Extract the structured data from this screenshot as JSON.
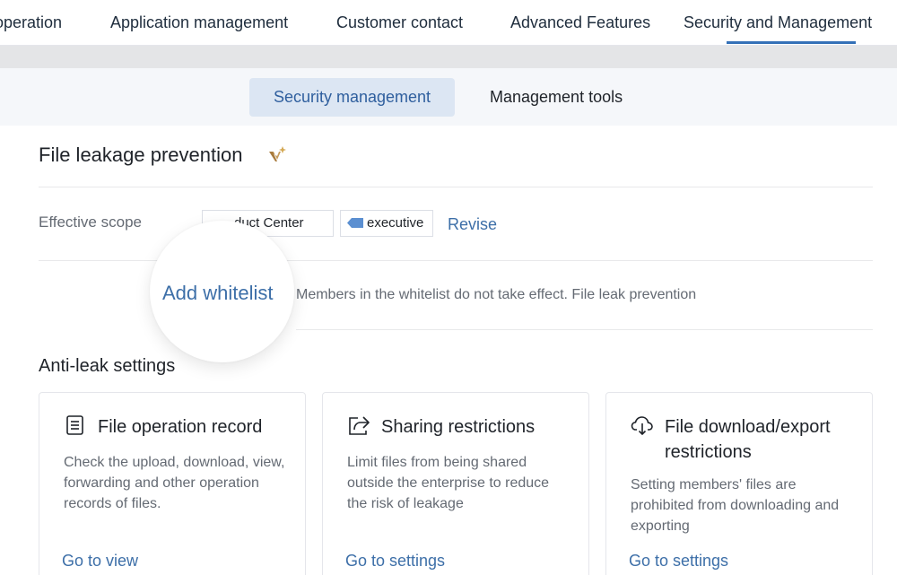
{
  "top_nav": {
    "items": [
      {
        "label": "operation"
      },
      {
        "label": "Application management"
      },
      {
        "label": "Customer contact"
      },
      {
        "label": "Advanced Features"
      },
      {
        "label": "Security and Management"
      }
    ],
    "active": "Security and Management"
  },
  "sub_tabs": {
    "items": [
      {
        "label": "Security management"
      },
      {
        "label": "Management tools"
      }
    ],
    "active": "Security management"
  },
  "file_leakage": {
    "title": "File leakage prevention",
    "scope_label": "Effective scope",
    "tags": [
      {
        "label": "Product Center",
        "visible_text": "duct Center"
      },
      {
        "label": "executive"
      }
    ],
    "revise_label": "Revise",
    "add_whitelist_label": "Add whitelist",
    "whitelist_note": "Members in the whitelist do not take effect. File leak prevention"
  },
  "anti_leak": {
    "title": "Anti-leak settings",
    "cards": [
      {
        "icon": "document-list-icon",
        "title": "File operation record",
        "description": "Check the upload, download, view, forwarding and other operation records of files.",
        "link": "Go to view"
      },
      {
        "icon": "share-icon",
        "title": "Sharing restrictions",
        "description": "Limit files from being shared outside the enterprise to reduce the risk of leakage",
        "link": "Go to settings"
      },
      {
        "icon": "cloud-download-icon",
        "title": "File download/export restrictions",
        "description": "Setting members' files are prohibited from downloading and exporting",
        "link": "Go to settings"
      }
    ]
  },
  "colors": {
    "accent": "#3370b7",
    "link": "#3d6fa8",
    "active_tab_bg": "#dce6f3",
    "vip_gold": "#c69c5d"
  }
}
